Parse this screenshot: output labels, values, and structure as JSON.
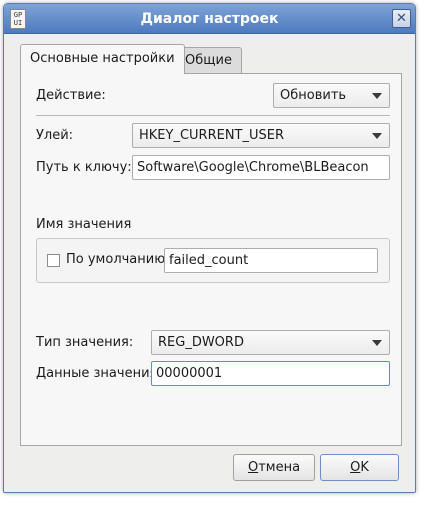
{
  "window": {
    "title": "Диалог настроек",
    "app_icon_text_line1": "GP",
    "app_icon_text_line2": "UI",
    "close_glyph": "✕"
  },
  "tabs": [
    {
      "label": "Основные настройки",
      "active": true
    },
    {
      "label": "Общие",
      "active": false
    }
  ],
  "action": {
    "label": "Действие:",
    "value": "Обновить"
  },
  "hive": {
    "label": "Улей:",
    "value": "HKEY_CURRENT_USER"
  },
  "key_path": {
    "label": "Путь к ключу:",
    "value": "Software\\Google\\Chrome\\BLBeacon"
  },
  "value_name": {
    "section_label": "Имя значения",
    "default_checkbox_label": "По умолчанию",
    "default_checked": false,
    "value": "failed_count"
  },
  "value_type": {
    "label": "Тип значения:",
    "value": "REG_DWORD"
  },
  "value_data": {
    "label": "Данные значения:",
    "value": "00000001"
  },
  "buttons": {
    "cancel_first": "О",
    "cancel_rest": "тмена",
    "ok_first": "O",
    "ok_rest": "K"
  },
  "colors": {
    "titlebar": "#4d7ac0",
    "focus": "#5b8dd6"
  }
}
